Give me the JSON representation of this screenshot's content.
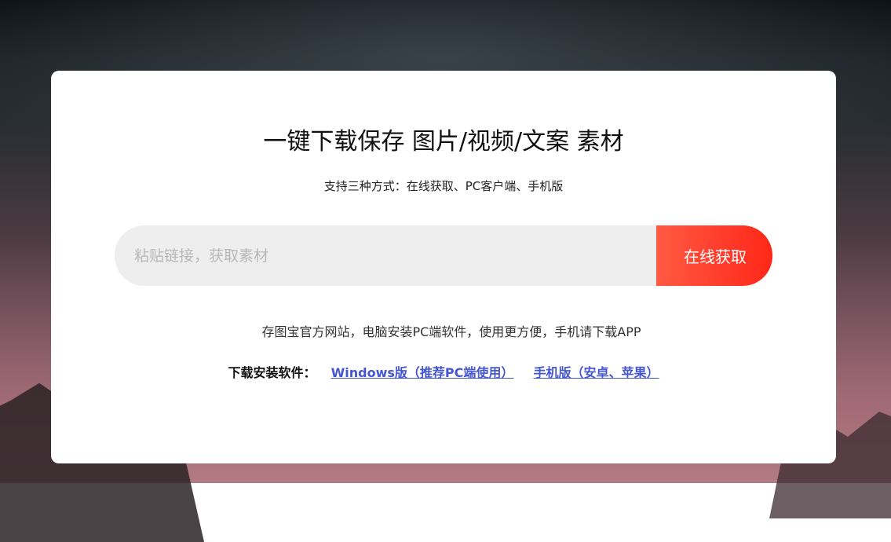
{
  "hero": {
    "title": "一键下载保存 图片/视频/文案 素材",
    "subtitle": "支持三种方式：在线获取、PC客户端、手机版"
  },
  "search": {
    "placeholder": "粘贴链接，获取素材",
    "value": "",
    "button_label": "在线获取"
  },
  "info": {
    "description": "存图宝官方网站，电脑安装PC端软件，使用更方便，手机请下载APP"
  },
  "downloads": {
    "label": "下载安装软件：",
    "windows_link": "Windows版（推荐PC端使用）",
    "mobile_link": "手机版（安卓、苹果）"
  },
  "colors": {
    "accent": "#ff3b2a",
    "link": "#4656d0",
    "input_bg": "#eeeeee"
  }
}
